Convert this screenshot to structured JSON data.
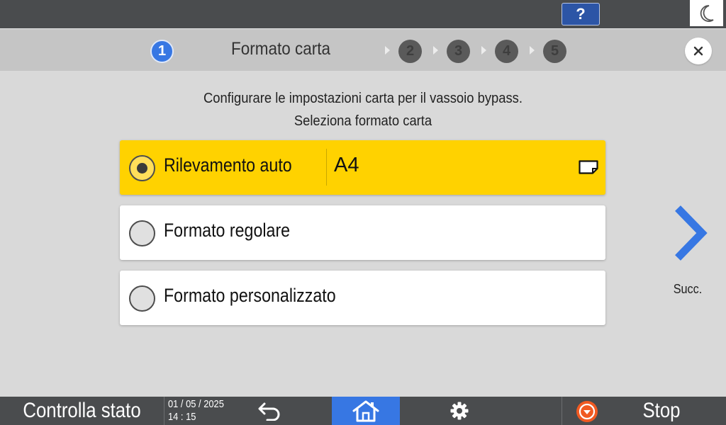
{
  "topbar": {
    "help_label": "?",
    "sleep_icon": "moon-icon"
  },
  "header": {
    "title": "Formato carta",
    "steps": [
      {
        "number": "1",
        "state": "active"
      },
      {
        "number": "2",
        "state": "inactive"
      },
      {
        "number": "3",
        "state": "inactive"
      },
      {
        "number": "4",
        "state": "inactive"
      },
      {
        "number": "5",
        "state": "inactive"
      }
    ],
    "close_icon": "close-icon"
  },
  "instructions": {
    "line1": "Configurare le impostazioni carta per il vassoio bypass.",
    "line2": "Seleziona formato carta"
  },
  "options": [
    {
      "label": "Rilevamento auto",
      "value": "A4",
      "selected": true,
      "icon": "paper-orientation-icon"
    },
    {
      "label": "Formato regolare",
      "selected": false
    },
    {
      "label": "Formato personalizzato",
      "selected": false
    }
  ],
  "next": {
    "label": "Succ.",
    "icon": "chevron-right-icon"
  },
  "bottombar": {
    "status_label": "Controlla stato",
    "date": "01 / 05 / 2025",
    "time": "14 : 15",
    "back_icon": "back-arrow-icon",
    "home_icon": "home-icon",
    "settings_icon": "gear-icon",
    "stop_icon": "stop-icon",
    "stop_label": "Stop"
  },
  "colors": {
    "accent": "#3777e3",
    "selected_option": "#ffd200",
    "bar": "#4a4c4e",
    "stop_orange": "#f05a22"
  }
}
